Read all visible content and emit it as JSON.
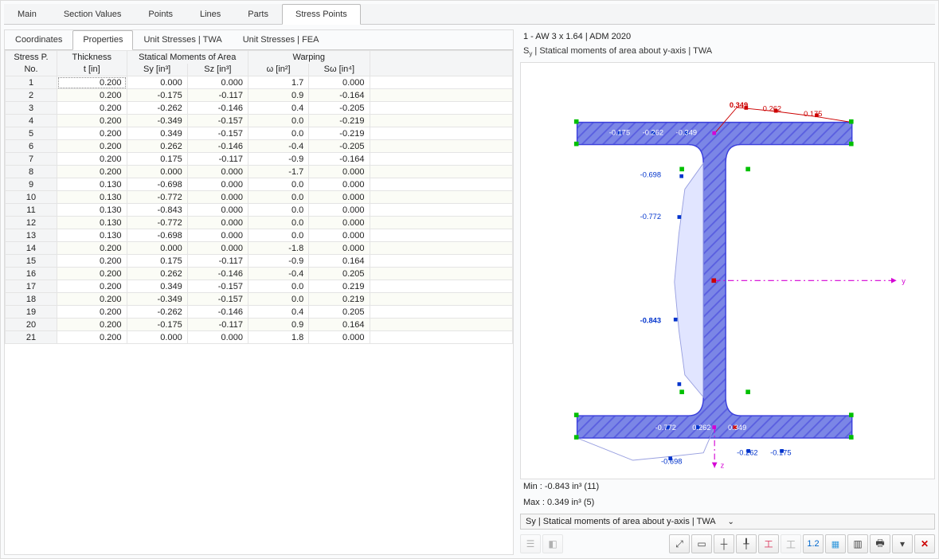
{
  "tabs": [
    "Main",
    "Section Values",
    "Points",
    "Lines",
    "Parts",
    "Stress Points"
  ],
  "activeTab": 5,
  "subtabs": [
    "Coordinates",
    "Properties",
    "Unit Stresses | TWA",
    "Unit Stresses | FEA"
  ],
  "activeSubtab": 1,
  "columns": {
    "rowno_top": "Stress P.",
    "rowno_bot": "No.",
    "thickness_top": "Thickness",
    "thickness_bot": "t [in]",
    "statmom_top": "Statical Moments of Area",
    "sy": "Sy [in³]",
    "sz": "Sz [in³]",
    "warp_top": "Warping",
    "omega": "ω [in²]",
    "sw": "Sω [in⁴]"
  },
  "rows": [
    {
      "n": 1,
      "t": "0.200",
      "sy": "0.000",
      "sz": "0.000",
      "w": "1.7",
      "sw": "0.000"
    },
    {
      "n": 2,
      "t": "0.200",
      "sy": "-0.175",
      "sz": "-0.117",
      "w": "0.9",
      "sw": "-0.164"
    },
    {
      "n": 3,
      "t": "0.200",
      "sy": "-0.262",
      "sz": "-0.146",
      "w": "0.4",
      "sw": "-0.205"
    },
    {
      "n": 4,
      "t": "0.200",
      "sy": "-0.349",
      "sz": "-0.157",
      "w": "0.0",
      "sw": "-0.219"
    },
    {
      "n": 5,
      "t": "0.200",
      "sy": "0.349",
      "sz": "-0.157",
      "w": "0.0",
      "sw": "-0.219"
    },
    {
      "n": 6,
      "t": "0.200",
      "sy": "0.262",
      "sz": "-0.146",
      "w": "-0.4",
      "sw": "-0.205"
    },
    {
      "n": 7,
      "t": "0.200",
      "sy": "0.175",
      "sz": "-0.117",
      "w": "-0.9",
      "sw": "-0.164"
    },
    {
      "n": 8,
      "t": "0.200",
      "sy": "0.000",
      "sz": "0.000",
      "w": "-1.7",
      "sw": "0.000"
    },
    {
      "n": 9,
      "t": "0.130",
      "sy": "-0.698",
      "sz": "0.000",
      "w": "0.0",
      "sw": "0.000"
    },
    {
      "n": 10,
      "t": "0.130",
      "sy": "-0.772",
      "sz": "0.000",
      "w": "0.0",
      "sw": "0.000"
    },
    {
      "n": 11,
      "t": "0.130",
      "sy": "-0.843",
      "sz": "0.000",
      "w": "0.0",
      "sw": "0.000"
    },
    {
      "n": 12,
      "t": "0.130",
      "sy": "-0.772",
      "sz": "0.000",
      "w": "0.0",
      "sw": "0.000"
    },
    {
      "n": 13,
      "t": "0.130",
      "sy": "-0.698",
      "sz": "0.000",
      "w": "0.0",
      "sw": "0.000"
    },
    {
      "n": 14,
      "t": "0.200",
      "sy": "0.000",
      "sz": "0.000",
      "w": "-1.8",
      "sw": "0.000"
    },
    {
      "n": 15,
      "t": "0.200",
      "sy": "0.175",
      "sz": "-0.117",
      "w": "-0.9",
      "sw": "0.164"
    },
    {
      "n": 16,
      "t": "0.200",
      "sy": "0.262",
      "sz": "-0.146",
      "w": "-0.4",
      "sw": "0.205"
    },
    {
      "n": 17,
      "t": "0.200",
      "sy": "0.349",
      "sz": "-0.157",
      "w": "0.0",
      "sw": "0.219"
    },
    {
      "n": 18,
      "t": "0.200",
      "sy": "-0.349",
      "sz": "-0.157",
      "w": "0.0",
      "sw": "0.219"
    },
    {
      "n": 19,
      "t": "0.200",
      "sy": "-0.262",
      "sz": "-0.146",
      "w": "0.4",
      "sw": "0.205"
    },
    {
      "n": 20,
      "t": "0.200",
      "sy": "-0.175",
      "sz": "-0.117",
      "w": "0.9",
      "sw": "0.164"
    },
    {
      "n": 21,
      "t": "0.200",
      "sy": "0.000",
      "sz": "0.000",
      "w": "1.8",
      "sw": "0.000"
    }
  ],
  "viewer": {
    "title": "1 - AW 3 x 1.64 | ADM 2020",
    "subtitle_html": "S<sub>y</sub> | Statical moments of area about y-axis | TWA",
    "min": "Min : -0.843 in³ (11)",
    "max": "Max :  0.349 in³ (5)",
    "axis_y": "y",
    "axis_z": "z",
    "labels": {
      "top_red": [
        "0.349",
        "0.262",
        "0.175"
      ],
      "top_white": [
        "-0.175",
        "-0.262",
        "-0.349"
      ],
      "web": [
        "-0.698",
        "-0.772",
        "-0.843"
      ],
      "bot_white": [
        "-0.772",
        "0.262",
        "0.349"
      ],
      "bot_blue": [
        "-0.698",
        "-0.262",
        "-0.175"
      ]
    }
  },
  "dropdown": {
    "label": "Sy | Statical moments of area about y-axis | TWA"
  },
  "toolbar_icons": [
    "tree",
    "window",
    "fit",
    "grid",
    "axes",
    "section1",
    "section2",
    "values",
    "grid2",
    "colors",
    "print",
    "drop",
    "clear"
  ]
}
